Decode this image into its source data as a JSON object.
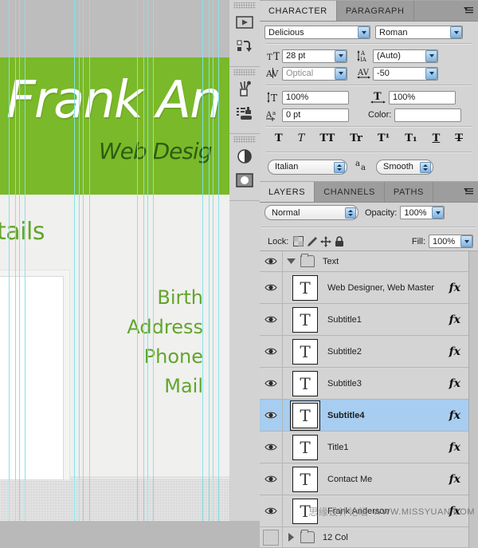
{
  "canvas": {
    "hero_name": "Frank An",
    "hero_subtitle": "Web Desig",
    "section_title": "tails",
    "contact_items": [
      "Birth",
      "Address",
      "Phone",
      "Mail"
    ],
    "colors": {
      "green_band": "#7ab929",
      "hero_text": "#ffffff",
      "subtitle_text": "#2d5d15",
      "accent_green": "#62a62a",
      "guide": "#7fe3e8",
      "page_bg": "#f0f0ef"
    },
    "guides_x": [
      11,
      19,
      24,
      31,
      93,
      99,
      104,
      112,
      172,
      180,
      185,
      192,
      254,
      262,
      267,
      274
    ]
  },
  "dock": {
    "groups": [
      {
        "icons": [
          {
            "name": "animation-icon",
            "label": "Animation"
          },
          {
            "name": "actions-icon",
            "label": "Actions"
          }
        ]
      },
      {
        "icons": [
          {
            "name": "brushes-icon",
            "label": "Brushes"
          },
          {
            "name": "clone-source-icon",
            "label": "Clone Source"
          }
        ]
      },
      {
        "icons": [
          {
            "name": "adjustments-icon",
            "label": "Adjustments"
          },
          {
            "name": "masks-icon",
            "label": "Masks"
          }
        ]
      }
    ]
  },
  "character_panel": {
    "tabs": [
      {
        "label": "CHARACTER",
        "active": true
      },
      {
        "label": "PARAGRAPH",
        "active": false
      }
    ],
    "menu_icon": "panel-menu-icon",
    "font_family": "Delicious",
    "font_style": "Roman",
    "font_size": "28 pt",
    "leading": "(Auto)",
    "kerning": "Optical",
    "tracking": "-50",
    "vertical_scale": "100%",
    "horizontal_scale": "100%",
    "baseline_shift": "0 pt",
    "color_label": "Color:",
    "color_value": "#ffffff",
    "style_buttons": [
      {
        "name": "faux-bold",
        "glyph": "T"
      },
      {
        "name": "faux-italic",
        "glyph": "T"
      },
      {
        "name": "all-caps",
        "glyph": "TT"
      },
      {
        "name": "small-caps",
        "glyph": "Tr"
      },
      {
        "name": "superscript",
        "glyph": "T¹"
      },
      {
        "name": "subscript",
        "glyph": "T₁"
      },
      {
        "name": "underline",
        "glyph": "T"
      },
      {
        "name": "strikethrough",
        "glyph": "T"
      }
    ],
    "language": "Italian",
    "antialias_label": "aa",
    "antialias": "Smooth"
  },
  "layers_panel": {
    "tabs": [
      {
        "label": "LAYERS",
        "active": true
      },
      {
        "label": "CHANNELS",
        "active": false
      },
      {
        "label": "PATHS",
        "active": false
      }
    ],
    "blend_mode": "Normal",
    "opacity_label": "Opacity:",
    "opacity": "100%",
    "lock_label": "Lock:",
    "lock_icons": [
      "lock-transparency-icon",
      "lock-image-icon",
      "lock-position-icon",
      "lock-all-icon"
    ],
    "fill_label": "Fill:",
    "fill": "100%",
    "group": {
      "name": "Text",
      "expanded": true,
      "visible": true
    },
    "layers": [
      {
        "name": "Web Designer, Web Master",
        "visible": true,
        "fx": "fx",
        "selected": false
      },
      {
        "name": "Subtitle1",
        "visible": true,
        "fx": "fx",
        "selected": false
      },
      {
        "name": "Subtitle2",
        "visible": true,
        "fx": "fx",
        "selected": false
      },
      {
        "name": "Subtitle3",
        "visible": true,
        "fx": "fx",
        "selected": false
      },
      {
        "name": "Subtitle4",
        "visible": true,
        "fx": "fx",
        "selected": true
      },
      {
        "name": "Title1",
        "visible": true,
        "fx": "fx",
        "selected": false
      },
      {
        "name": "Contact Me",
        "visible": true,
        "fx": "fx",
        "selected": false
      },
      {
        "name": "Frank Anderson",
        "visible": true,
        "fx": "fx",
        "selected": false
      }
    ],
    "bottom_group": {
      "name": "12 Col",
      "expanded": false,
      "visible": false
    },
    "selected_color": "#a7cdf0"
  },
  "watermark": {
    "cn_text": "思缘设计论坛",
    "url_text": "WWW.MISSYUAN.COM"
  }
}
